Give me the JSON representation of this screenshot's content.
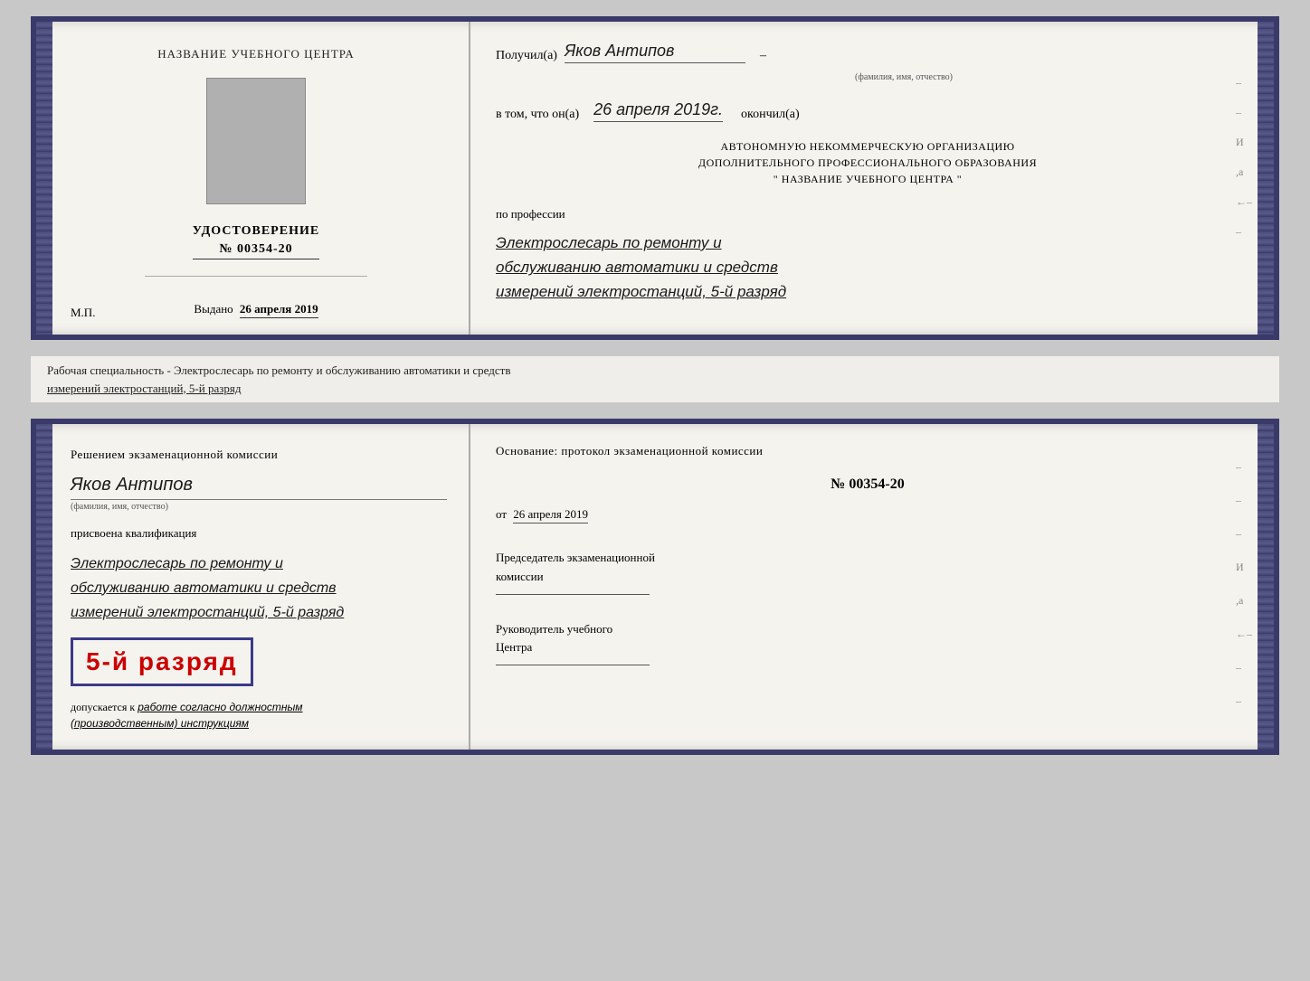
{
  "top_cert": {
    "left": {
      "title": "НАЗВАНИЕ УЧЕБНОГО ЦЕНТРА",
      "photo_alt": "photo",
      "udostoverenie": "УДОСТОВЕРЕНИЕ",
      "number": "№ 00354-20",
      "issued_label": "Выдано",
      "issued_date": "26 апреля 2019",
      "mp": "М.П."
    },
    "right": {
      "poluchil_label": "Получил(а)",
      "recipient_name": "Яков Антипов",
      "fio_label": "(фамилия, имя, отчество)",
      "vtom_label": "в том, что он(а)",
      "date_value": "26 апреля 2019г.",
      "okonchil": "окончил(а)",
      "org_line1": "АВТОНОМНУЮ НЕКОММЕРЧЕСКУЮ ОРГАНИЗАЦИЮ",
      "org_line2": "ДОПОЛНИТЕЛЬНОГО ПРОФЕССИОНАЛЬНОГО ОБРАЗОВАНИЯ",
      "org_quote_open": "\"",
      "org_name": "НАЗВАНИЕ УЧЕБНОГО ЦЕНТРА",
      "org_quote_close": "\"",
      "po_professii": "по профессии",
      "profession_line1": "Электрослесарь по ремонту и",
      "profession_line2": "обслуживанию автоматики и средств",
      "profession_line3": "измерений электростанций, 5-й разряд",
      "right_marks": [
        "-",
        "-",
        "-",
        "И",
        "а",
        "←",
        "-"
      ]
    }
  },
  "between": {
    "text_line1": "Рабочая специальность - Электрослесарь по ремонту и обслуживанию автоматики и средств",
    "text_line2": "измерений электростанций, 5-й разряд"
  },
  "bottom_cert": {
    "left": {
      "resheniem": "Решением экзаменационной комиссии",
      "name": "Яков Антипов",
      "fio_label": "(фамилия, имя, отчество)",
      "prisvoyena": "присвоена квалификация",
      "qual_line1": "Электрослесарь по ремонту и",
      "qual_line2": "обслуживанию автоматики и средств",
      "qual_line3": "измерений электростанций, 5-й разряд",
      "rank_text": "5-й разряд",
      "dopuskaetsya": "допускается к",
      "work_text": "работе согласно должностным",
      "instruction_text": "(производственным) инструкциям"
    },
    "right": {
      "osnovanie": "Основание: протокол экзаменационной комиссии",
      "protocol_number": "№ 00354-20",
      "ot_label": "от",
      "protocol_date": "26 апреля 2019",
      "chairman_label": "Председатель экзаменационной",
      "chairman_label2": "комиссии",
      "rukovoditel_label": "Руководитель учебного",
      "rukovoditel_label2": "Центра",
      "right_marks": [
        "-",
        "-",
        "-",
        "И",
        "а",
        "←",
        "-",
        "-",
        "-"
      ]
    }
  }
}
